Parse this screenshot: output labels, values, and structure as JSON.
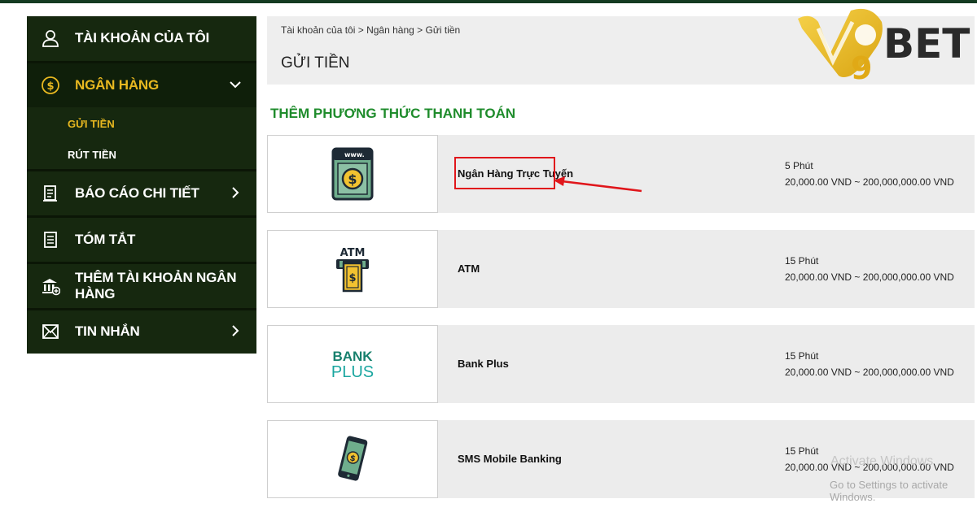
{
  "brand": {
    "logo_text": "BET",
    "logo_digit": "9",
    "gold": "#e8b820",
    "dark_green": "#16280f",
    "green_title": "#1f8c2c"
  },
  "sidebar": {
    "items": [
      {
        "label": "TÀI KHOẢN CỦA TÔI",
        "icon": "user-icon"
      },
      {
        "label": "NGÂN HÀNG",
        "icon": "dollar-coin-icon",
        "expanded": true
      },
      {
        "label": "BÁO CÁO CHI TIẾT",
        "icon": "report-icon"
      },
      {
        "label": "TÓM TẮT",
        "icon": "document-icon"
      },
      {
        "label": "THÊM TÀI KHOẢN NGÂN HÀNG",
        "icon": "bank-add-icon"
      },
      {
        "label": "TIN NHẮN",
        "icon": "envelope-icon"
      }
    ],
    "subitems": [
      {
        "label": "GỬI TIỀN",
        "active": true
      },
      {
        "label": "RÚT TIỀN",
        "active": false
      }
    ]
  },
  "breadcrumb": {
    "items": [
      "Tài khoản của tôi",
      "Ngân hàng",
      "Gửi tiền"
    ],
    "separator": ">"
  },
  "page_title": "GỬI TIỀN",
  "section_title": "THÊM PHƯƠNG THỨC THANH TOÁN",
  "payment_methods": [
    {
      "name": "Ngân Hàng Trực Tuyến",
      "time": "5 Phút",
      "range": "20,000.00 VND ~ 200,000,000.00 VND",
      "icon": "online-banking-icon",
      "icon_label": "www."
    },
    {
      "name": "ATM",
      "time": "15 Phút",
      "range": "20,000.00 VND ~ 200,000,000.00 VND",
      "icon": "atm-icon",
      "icon_label": "ATM"
    },
    {
      "name": "Bank Plus",
      "time": "15 Phút",
      "range": "20,000.00 VND ~ 200,000,000.00 VND",
      "icon": "bank-plus-logo",
      "icon_label_1": "BANK",
      "icon_label_2": "PLUS"
    },
    {
      "name": "SMS Mobile Banking",
      "time": "15 Phút",
      "range": "20,000.00 VND ~ 200,000,000.00 VND",
      "icon": "mobile-banking-icon"
    }
  ],
  "watermark": {
    "line1": "Activate Windows",
    "line2": "Go to Settings to activate Windows."
  }
}
